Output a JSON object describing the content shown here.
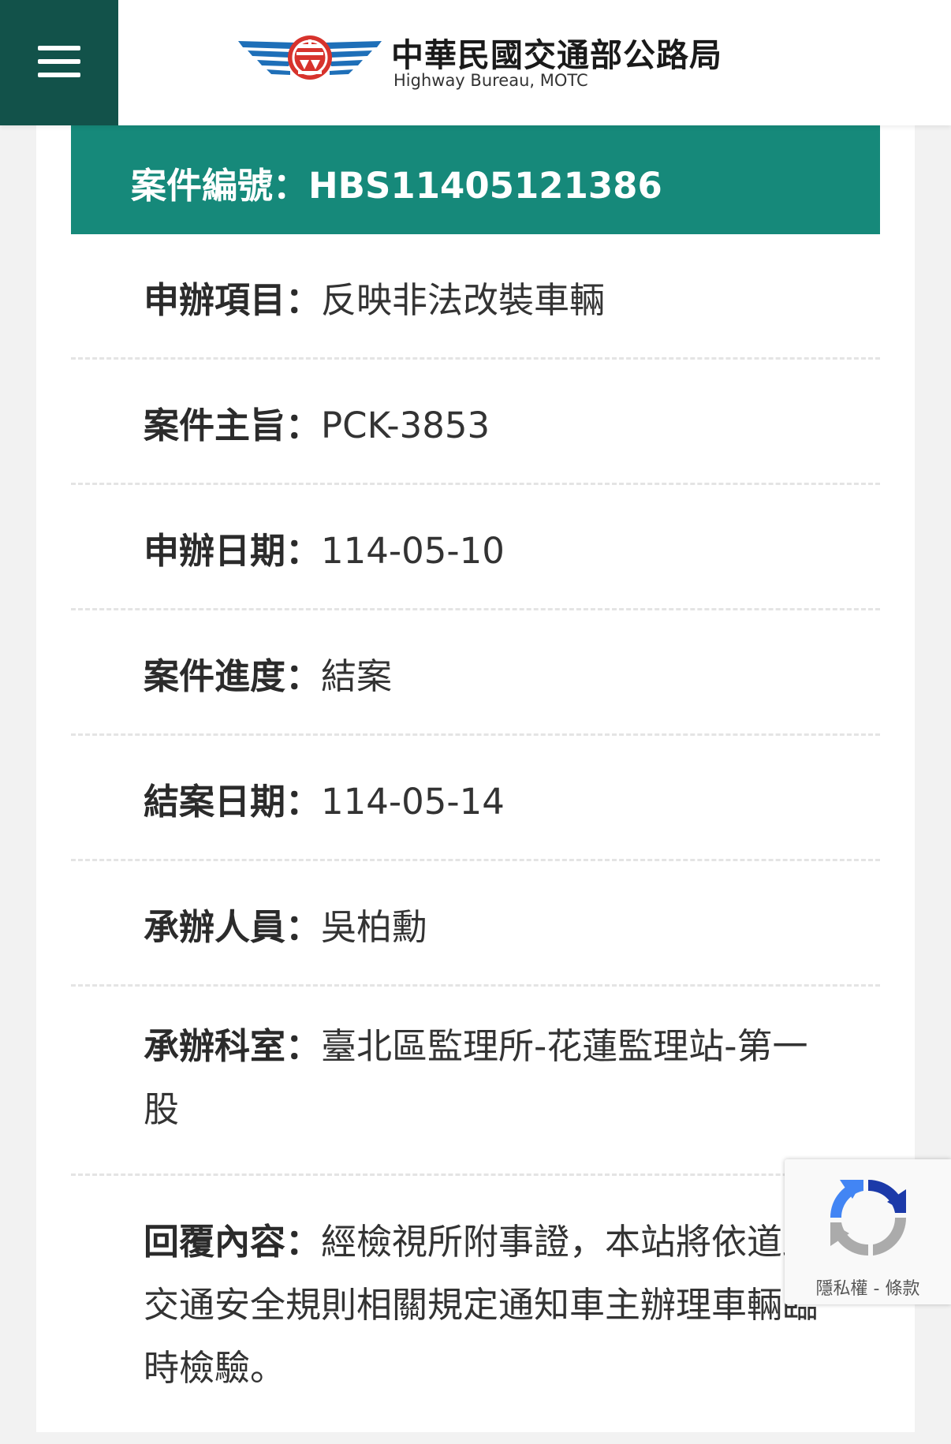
{
  "header": {
    "title": "中華民國交通部公路局",
    "subtitle": "Highway Bureau, MOTC",
    "menu_icon": "hamburger-menu-icon",
    "emblem_icon": "highway-bureau-emblem-icon"
  },
  "case": {
    "banner_label": "案件編號：",
    "case_number": "HBS11405121386"
  },
  "fields": [
    {
      "label": "申辦項目：",
      "value": "反映非法改裝車輛"
    },
    {
      "label": "案件主旨：",
      "value": "PCK-3853"
    },
    {
      "label": "申辦日期：",
      "value": "114-05-10"
    },
    {
      "label": "案件進度：",
      "value": "結案"
    },
    {
      "label": "結案日期：",
      "value": "114-05-14"
    },
    {
      "label": "承辦人員：",
      "value": "吳柏勳"
    },
    {
      "label": "承辦科室：",
      "value": "臺北區監理所-花蓮監理站-第一股"
    },
    {
      "label": "回覆內容：",
      "value": "經檢視所附事證，本站將依道路交通安全規則相關規定通知車主辦理車輛臨時檢驗。"
    }
  ],
  "recaptcha": {
    "privacy": "隱私權",
    "separator": " - ",
    "terms": "條款",
    "icon": "recaptcha-icon"
  },
  "colors": {
    "menu_bg": "#12524a",
    "banner_bg": "#16897a",
    "emblem_red": "#d7332c",
    "emblem_blue": "#1e6fb8"
  }
}
